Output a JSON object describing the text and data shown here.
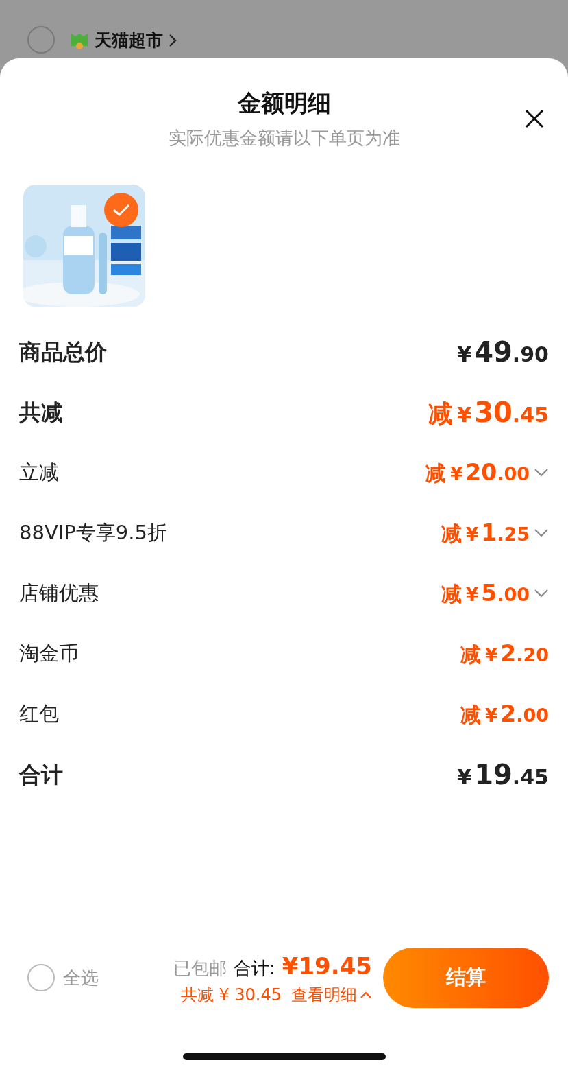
{
  "background_store": {
    "selected": false,
    "name": "天猫超市"
  },
  "sheet": {
    "title": "金额明细",
    "subtitle": "实际优惠金额请以下单页为准"
  },
  "product": {
    "kind": "picture",
    "selected": true
  },
  "rows": [
    {
      "kind": "total",
      "label": "商品总价",
      "prefix": "",
      "currency": "¥",
      "integer": "49",
      "decimal": ".90",
      "expandable": false
    },
    {
      "kind": "discount_total",
      "label": "共减",
      "prefix": "减",
      "currency": "¥",
      "integer": "30",
      "decimal": ".45",
      "expandable": false
    },
    {
      "kind": "discount",
      "label": "立减",
      "prefix": "减",
      "currency": "¥",
      "integer": "20",
      "decimal": ".00",
      "expandable": true
    },
    {
      "kind": "discount",
      "label": "88VIP专享9.5折",
      "prefix": "减",
      "currency": "¥",
      "integer": "1",
      "decimal": ".25",
      "expandable": true
    },
    {
      "kind": "discount",
      "label": "店铺优惠",
      "prefix": "减",
      "currency": "¥",
      "integer": "5",
      "decimal": ".00",
      "expandable": true
    },
    {
      "kind": "discount",
      "label": "淘金币",
      "prefix": "减",
      "currency": "¥",
      "integer": "2",
      "decimal": ".20",
      "expandable": false
    },
    {
      "kind": "discount",
      "label": "红包",
      "prefix": "减",
      "currency": "¥",
      "integer": "2",
      "decimal": ".00",
      "expandable": false
    },
    {
      "kind": "total",
      "label": "合计",
      "prefix": "",
      "currency": "¥",
      "integer": "19",
      "decimal": ".45",
      "expandable": false
    }
  ],
  "bottom_bar": {
    "select_all": {
      "label": "全选",
      "checked": false
    },
    "shipping": "已包邮",
    "total_label": "合计:",
    "total_amount": "¥19.45",
    "discount_summary": "共减 ¥ 30.45",
    "details_link": "查看明细",
    "details_expanded": true,
    "checkout": "结算"
  }
}
